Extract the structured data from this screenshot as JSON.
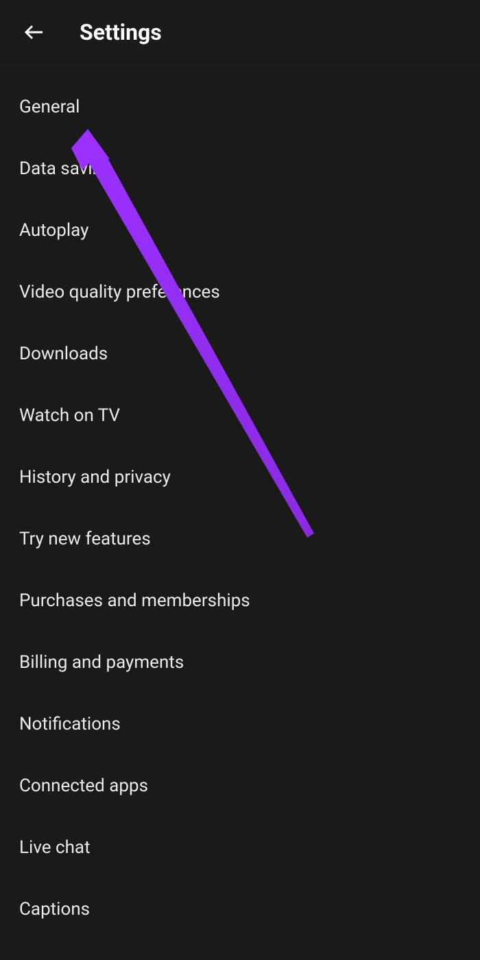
{
  "header": {
    "title": "Settings"
  },
  "settings": {
    "items": [
      {
        "label": "General"
      },
      {
        "label": "Data saving"
      },
      {
        "label": "Autoplay"
      },
      {
        "label": "Video quality preferences"
      },
      {
        "label": "Downloads"
      },
      {
        "label": "Watch on TV"
      },
      {
        "label": "History and privacy"
      },
      {
        "label": "Try new features"
      },
      {
        "label": "Purchases and memberships"
      },
      {
        "label": "Billing and payments"
      },
      {
        "label": "Notifications"
      },
      {
        "label": "Connected apps"
      },
      {
        "label": "Live chat"
      },
      {
        "label": "Captions"
      }
    ]
  },
  "annotation": {
    "color": "#8a2be2"
  }
}
